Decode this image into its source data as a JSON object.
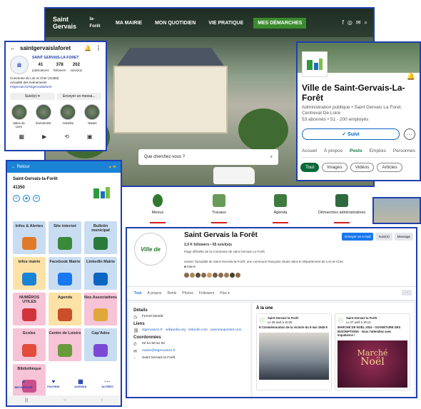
{
  "website": {
    "logo_line1": "Saint Gervais",
    "logo_line2": "la-Forêt",
    "nav": [
      "MA MAIRIE",
      "MON QUOTIDIEN",
      "VIE PRATIQUE",
      "MES DÉMARCHES"
    ],
    "search_placeholder": "Que cherchez-vous ?"
  },
  "instagram": {
    "username": "saintgervaislaforet",
    "display_name": "SAINT GERVAIS-LA-FORET",
    "stats": [
      {
        "value": "41",
        "label": "publications"
      },
      {
        "value": "378",
        "label": "followers"
      },
      {
        "value": "202",
        "label": "suivi(e)s"
      }
    ],
    "bio_line1": "Commune du Loir et Cher (41350)",
    "bio_line2": "Actualité des événements",
    "bio_line3": "#stgervais41#stgervaislaforet",
    "btn_follow": "Suivi(e) ▾",
    "btn_message": "Envoyer un messa...",
    "highlights": [
      "Salon du Livre",
      "Événement",
      "Activités",
      "Nature"
    ]
  },
  "linkedin": {
    "title": "Ville de Saint-Gervais-La-Forêt",
    "subtitle": "Administration publique • Saint Gervais La Foret, Centreval De Loire",
    "meta": "53 abonnés • 51 - 200 employés",
    "follow": "✓ Suivi",
    "tabs": [
      "Accueil",
      "À propos",
      "Posts",
      "Emplois",
      "Personnes"
    ],
    "chips": [
      "Tout",
      "Images",
      "Vidéos",
      "Articles"
    ]
  },
  "app": {
    "back": "← Retour",
    "town": "Saint-Gervais-la-Forêt",
    "postcode": "41350",
    "tiles": [
      {
        "label": "Infos & Alertes",
        "bg": "#c9ddf2",
        "ico": "#e07a2a"
      },
      {
        "label": "Site internet",
        "bg": "#c9ddf2",
        "ico": "#3a8a3a"
      },
      {
        "label": "Bulletin municipal",
        "bg": "#c9ddf2",
        "ico": "#2a7a3a"
      },
      {
        "label": "Infos mairie",
        "bg": "#fde2a8",
        "ico": "#1a83d6"
      },
      {
        "label": "Facebook Mairie",
        "bg": "#c9ddf2",
        "ico": "#1877f2"
      },
      {
        "label": "LinkedIn Mairie",
        "bg": "#c9ddf2",
        "ico": "#0a66c2"
      },
      {
        "label": "NUMÉROS UTILES",
        "bg": "#f7c3d6",
        "ico": "#d2343c"
      },
      {
        "label": "Agenda",
        "bg": "#fde2a8",
        "ico": "#c84f2a"
      },
      {
        "label": "Nos Associations",
        "bg": "#f7c3d6",
        "ico": "#e0a83a"
      },
      {
        "label": "Ecoles",
        "bg": "#f7c3d6",
        "ico": "#e24c3a"
      },
      {
        "label": "Centre de Loisirs",
        "bg": "#f7c3d6",
        "ico": "#6a9a3a"
      },
      {
        "label": "Cap'Ados",
        "bg": "#c9ddf2",
        "ico": "#7a4ad6"
      },
      {
        "label": "Bibliothèque",
        "bg": "#f7c3d6",
        "ico": "#c84f8a"
      }
    ],
    "nav": [
      "RECHERCHE",
      "FAVORIS",
      "AGENDA",
      "AUTRES"
    ]
  },
  "strip": {
    "items": [
      "Menus",
      "Travaux",
      "Agenda",
      "Démarches administratives"
    ]
  },
  "facebook": {
    "name": "Saint Gervais la Forêt",
    "followers": "2,9 K followers • 65 suivi(e)s",
    "desc1": "Page officielle de la Commune de saint Gervais La Forêt",
    "desc2": "Suivez l'actualité de Saint-Gervais-la-Forêt, une commune française située dans le département de Loir-et-Cher.",
    "category": "■ Mairie",
    "btn_message": "Envoyer un e-mail",
    "btn_follow": "Suivi(e)",
    "btn_msg2": "Message",
    "tabs": [
      "Tout",
      "À propos",
      "Reels",
      "Photos",
      "Followers",
      "Plus ▾"
    ],
    "details_title": "Détails",
    "closed": "Fermé bientôt",
    "links_title": "Liens",
    "links": "stgervais41.fr · wikipedia.org · linkedin.com · panneaupocket.com",
    "coords_title": "Coordonnées",
    "phone": "02 54 50 51 52",
    "email": "mairie@stgervais41.fr",
    "messenger": "Saint Gervais la Forêt",
    "highlight_title": "À la une",
    "cards": [
      {
        "page": "Saint Gervais la Forêt",
        "date": "Le 28 avril à 10:25",
        "text": "8 Commémoration de la victoire du 8 mai 1945 8"
      },
      {
        "page": "Saint Gervais la Forêt",
        "date": "Le 27 avril à 19:13",
        "text": "MARCHÉ DE NOËL 2024 - OUVERTURE DES INSCRIPTIONS · Vous l'attendiez avec impatience !"
      }
    ],
    "card2_image_line1": "Marché",
    "card2_image_line2": "Noël"
  }
}
